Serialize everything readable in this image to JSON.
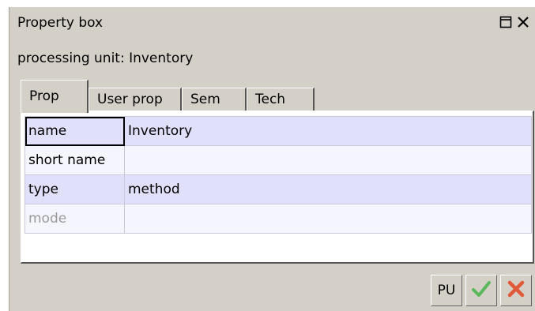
{
  "window": {
    "title": "Property box"
  },
  "subtitle": "processing unit: Inventory",
  "tabs": [
    {
      "label": "Prop",
      "active": true
    },
    {
      "label": "User prop",
      "active": false
    },
    {
      "label": "Sem",
      "active": false
    },
    {
      "label": "Tech",
      "active": false
    }
  ],
  "properties": [
    {
      "key": "name",
      "value": "Inventory"
    },
    {
      "key": "short name",
      "value": ""
    },
    {
      "key": "type",
      "value": "method"
    },
    {
      "key": "mode",
      "value": ""
    }
  ],
  "footer": {
    "pu_label": "PU"
  },
  "icons": {
    "restore": "restore-window-icon",
    "close": "close-icon",
    "ok": "green-checkmark-icon",
    "cancel": "red-x-icon"
  },
  "colors": {
    "ok_green": "#4caf50",
    "cancel_red": "#e05a3a",
    "row_shade": "#e0e0fa",
    "row_light": "#f5f5fd",
    "background": "#d4d0c8"
  }
}
